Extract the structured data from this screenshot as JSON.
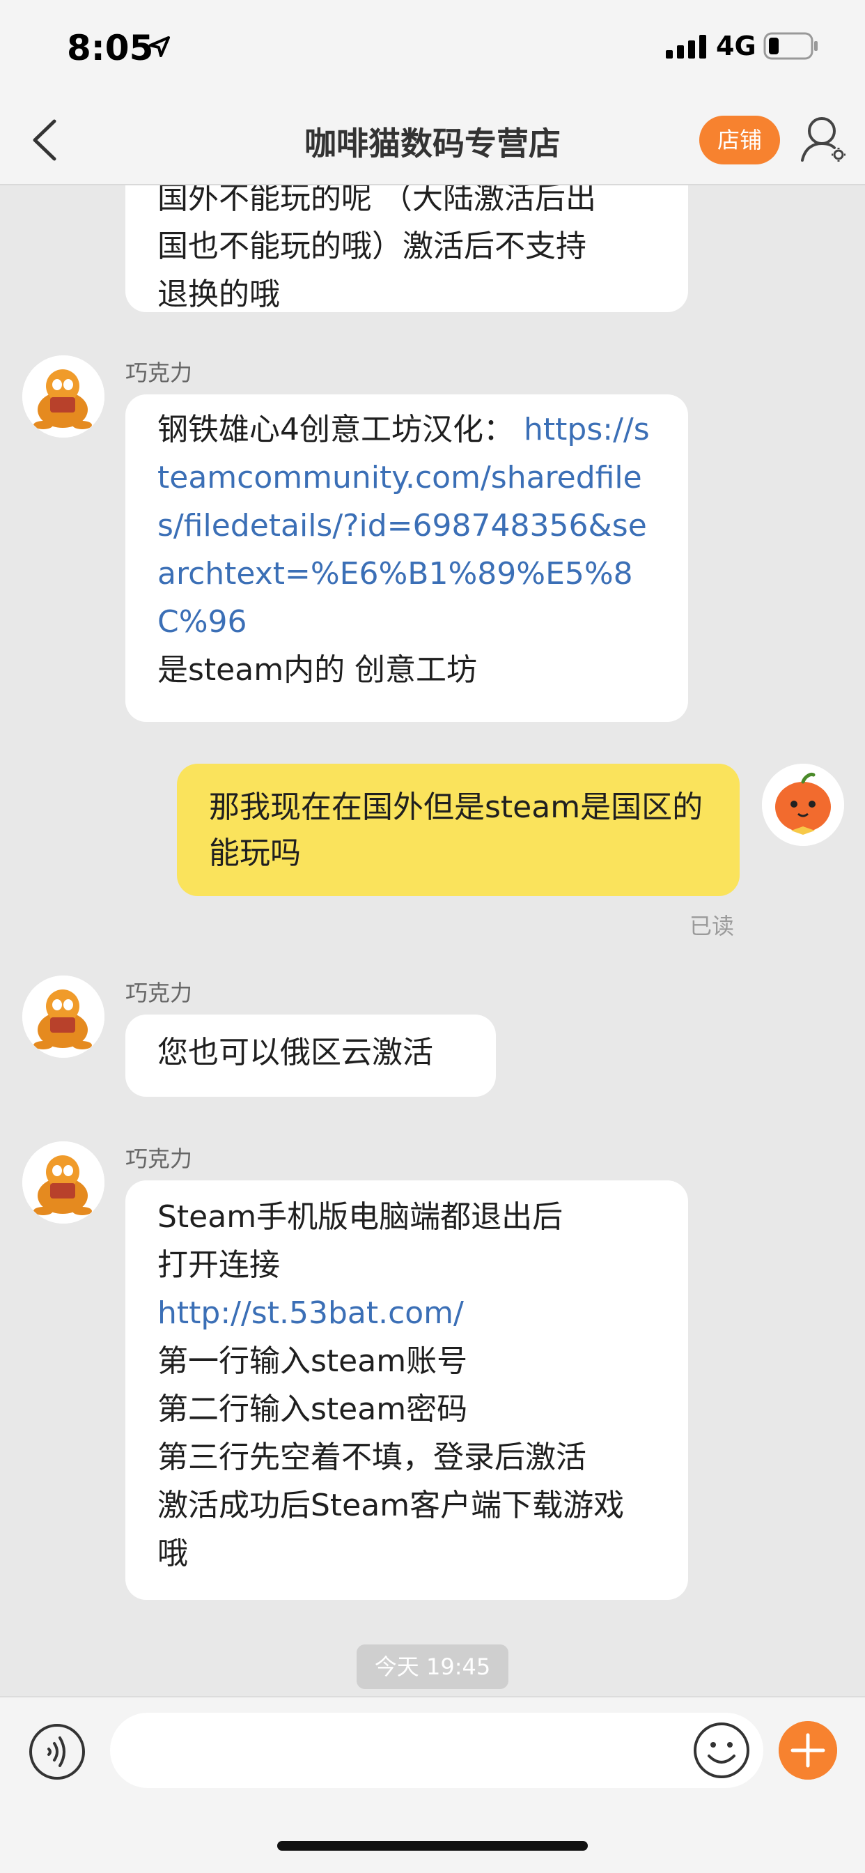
{
  "status_bar": {
    "time": "8:05",
    "network": "4G"
  },
  "header": {
    "title": "咖啡猫数码专营店",
    "shop_label": "店铺"
  },
  "messages": [
    {
      "lines": [
        "国外不能玩的呢 （大陆激活后出",
        "国也不能玩的哦）激活后不支持",
        "退换的哦"
      ]
    },
    {
      "sender": "巧克力",
      "text_before_link": "钢铁雄心4创意工坊汉化：",
      "link": "https://steamcommunity.com/sharedfiles/filedetails/?id=698748356&searchtext=%E6%B1%89%E5%8C%96",
      "text_after_link": "是steam内的 创意工坊"
    },
    {
      "sender": "me",
      "text": "那我现在在国外但是steam是国区的能玩吗",
      "read_status": "已读"
    },
    {
      "sender": "巧克力",
      "text": "您也可以俄区云激活"
    },
    {
      "sender": "巧克力",
      "line1": "Steam手机版电脑端都退出后",
      "line2": "打开连接",
      "link": "http://st.53bat.com/",
      "line3": "第一行输入steam账号",
      "line4": "第二行输入steam密码",
      "line5": "第三行先空着不填，登录后激活",
      "line6": "激活成功后Steam客户端下载游戏哦"
    }
  ],
  "timestamp": "今天 19:45",
  "colors": {
    "accent": "#f7822f",
    "my_bubble": "#fae35c",
    "link": "#3b6fb6",
    "background": "#e8e8e8"
  }
}
